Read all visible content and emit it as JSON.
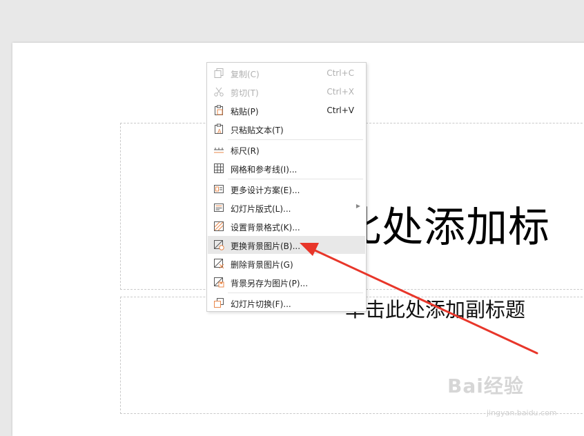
{
  "slide": {
    "title_placeholder": "此处添加标",
    "subtitle_placeholder": "单击此处添加副标题"
  },
  "context_menu": {
    "items": [
      {
        "label": "复制(C)",
        "shortcut": "Ctrl+C",
        "disabled": true,
        "icon": "copy-icon"
      },
      {
        "label": "剪切(T)",
        "shortcut": "Ctrl+X",
        "disabled": true,
        "icon": "scissors-icon"
      },
      {
        "label": "粘贴(P)",
        "shortcut": "Ctrl+V",
        "disabled": false,
        "icon": "paste-icon"
      },
      {
        "label": "只粘贴文本(T)",
        "shortcut": "",
        "disabled": false,
        "icon": "paste-text-icon"
      },
      {
        "label": "标尺(R)",
        "shortcut": "",
        "disabled": false,
        "icon": "ruler-icon"
      },
      {
        "label": "网格和参考线(I)...",
        "shortcut": "",
        "disabled": false,
        "icon": "grid-icon"
      },
      {
        "label": "更多设计方案(E)...",
        "shortcut": "",
        "disabled": false,
        "icon": "design-icon"
      },
      {
        "label": "幻灯片版式(L)...",
        "shortcut": "",
        "disabled": false,
        "icon": "layout-icon"
      },
      {
        "label": "设置背景格式(K)...",
        "shortcut": "",
        "disabled": false,
        "icon": "background-format-icon"
      },
      {
        "label": "更换背景图片(B)...",
        "shortcut": "",
        "disabled": false,
        "icon": "change-background-icon"
      },
      {
        "label": "删除背景图片(G)",
        "shortcut": "",
        "disabled": false,
        "icon": "delete-background-icon"
      },
      {
        "label": "背景另存为图片(P)...",
        "shortcut": "",
        "disabled": false,
        "icon": "save-background-icon"
      },
      {
        "label": "幻灯片切换(F)...",
        "shortcut": "",
        "disabled": false,
        "icon": "slide-transition-icon"
      }
    ]
  },
  "watermark": {
    "brand": "Bai经验",
    "url": "jingyan.baidu.com"
  },
  "colors": {
    "accent_orange": "#e9874a",
    "annotation_arrow": "#e8362a",
    "hover_background": "#e8e8e8"
  }
}
